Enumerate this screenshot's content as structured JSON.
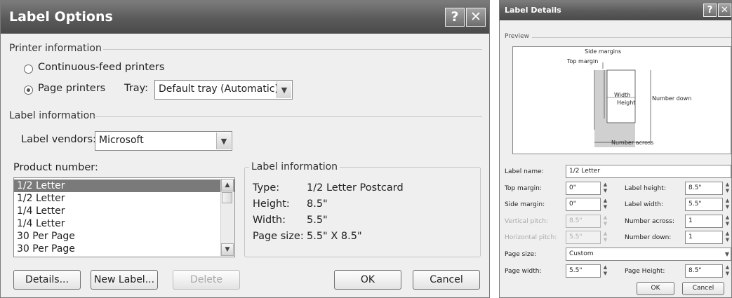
{
  "label_options": {
    "title": "Label Options",
    "help_glyph": "?",
    "close_glyph": "✕",
    "printer_info_heading": "Printer information",
    "continuous_feed_label": "Continuous-feed printers",
    "page_printers_label": "Page printers",
    "tray_label": "Tray:",
    "tray_value": "Default tray (Automatic)",
    "label_info_heading": "Label information",
    "label_vendors_label": "Label vendors:",
    "label_vendors_value": "Microsoft",
    "product_number_label": "Product number:",
    "product_numbers": [
      "1/2 Letter",
      "1/2 Letter",
      "1/4 Letter",
      "1/4 Letter",
      "30 Per Page",
      "30 Per Page"
    ],
    "label_information_group": "Label information",
    "info_rows": [
      {
        "key": "Type:",
        "value": "1/2 Letter Postcard"
      },
      {
        "key": "Height:",
        "value": "8.5\""
      },
      {
        "key": "Width:",
        "value": "5.5\""
      },
      {
        "key": "Page size:",
        "value": "5.5\" X 8.5\""
      }
    ],
    "details_button": "Details...",
    "new_label_button": "New Label...",
    "delete_button": "Delete",
    "ok_button": "OK",
    "cancel_button": "Cancel"
  },
  "label_details": {
    "title": "Label Details",
    "help_glyph": "?",
    "close_glyph": "✕",
    "preview_heading": "Preview",
    "preview_labels": {
      "side_margins": "Side margins",
      "top_margin": "Top margin",
      "width": "Width",
      "height": "Height",
      "number_down": "Number down",
      "number_across": "Number across"
    },
    "label_name_label": "Label name:",
    "label_name_value": "1/2 Letter",
    "top_margin_label": "Top margin:",
    "top_margin_value": "0\"",
    "side_margin_label": "Side margin:",
    "side_margin_value": "0\"",
    "vertical_pitch_label": "Vertical pitch:",
    "vertical_pitch_value": "8.5\"",
    "horizontal_pitch_label": "Horizontal pitch:",
    "horizontal_pitch_value": "5.5\"",
    "label_height_label": "Label height:",
    "label_height_value": "8.5\"",
    "label_width_label": "Label width:",
    "label_width_value": "5.5\"",
    "number_across_label": "Number across:",
    "number_across_value": "1",
    "number_down_label": "Number down:",
    "number_down_value": "1",
    "page_size_label": "Page size:",
    "page_size_value": "Custom",
    "page_width_label": "Page width:",
    "page_width_value": "5.5\"",
    "page_height_label": "Page Height:",
    "page_height_value": "8.5\"",
    "ok_button": "OK",
    "cancel_button": "Cancel"
  }
}
